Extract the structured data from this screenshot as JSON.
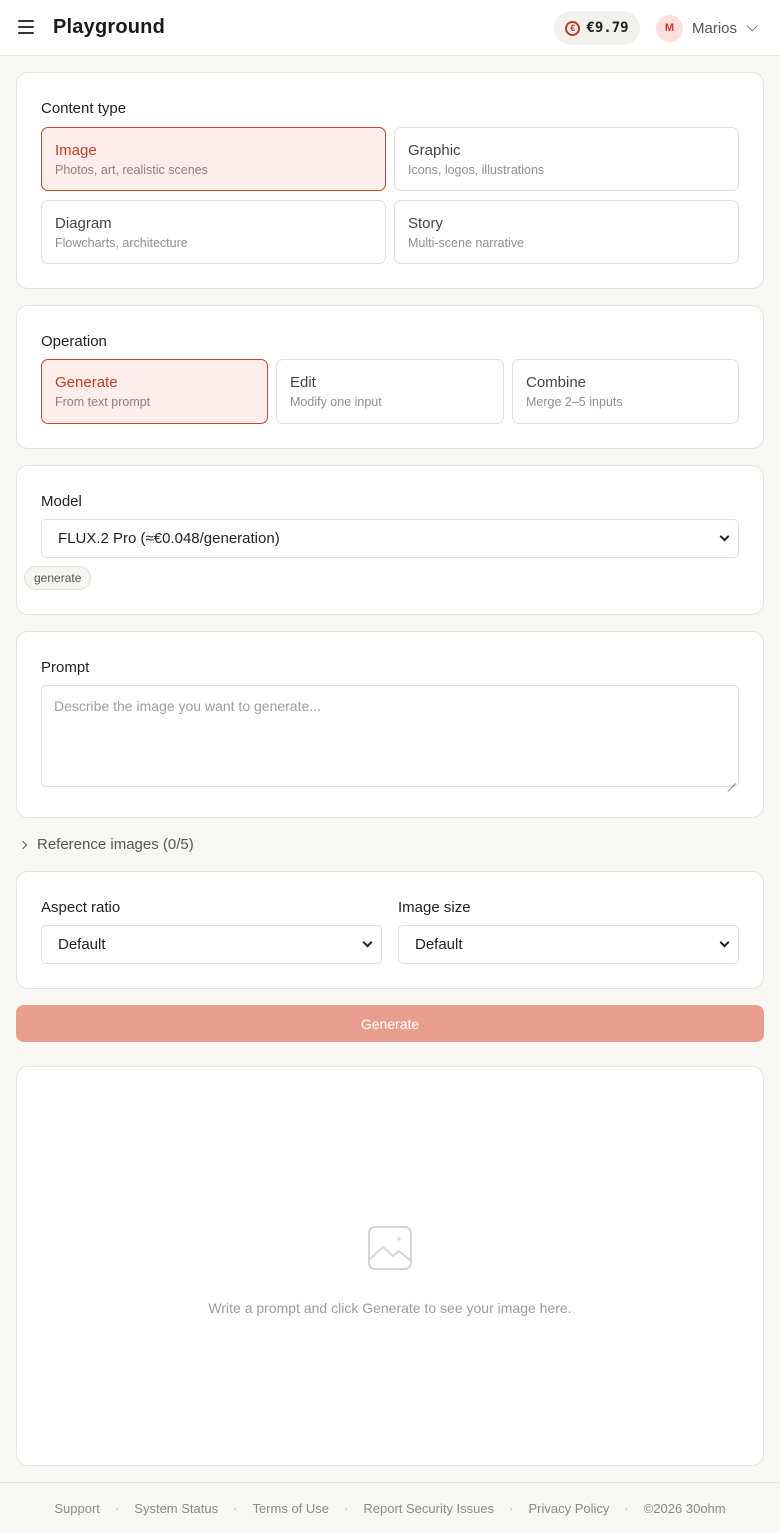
{
  "header": {
    "title": "Playground",
    "balance": "€9.79",
    "balance_icon": "€",
    "user_initial": "M",
    "user_name": "Marios"
  },
  "content_type": {
    "label": "Content type",
    "options": [
      {
        "title": "Image",
        "sub": "Photos, art, realistic scenes",
        "selected": true
      },
      {
        "title": "Graphic",
        "sub": "Icons, logos, illustrations",
        "selected": false
      },
      {
        "title": "Diagram",
        "sub": "Flowcharts, architecture",
        "selected": false
      },
      {
        "title": "Story",
        "sub": "Multi-scene narrative",
        "selected": false
      }
    ]
  },
  "operation": {
    "label": "Operation",
    "options": [
      {
        "title": "Generate",
        "sub": "From text prompt",
        "selected": true
      },
      {
        "title": "Edit",
        "sub": "Modify one input",
        "selected": false
      },
      {
        "title": "Combine",
        "sub": "Merge 2–5 inputs",
        "selected": false
      }
    ]
  },
  "model": {
    "label": "Model",
    "selected": "FLUX.2 Pro (≈€0.048/generation)",
    "tag": "generate"
  },
  "prompt": {
    "label": "Prompt",
    "placeholder": "Describe the image you want to generate..."
  },
  "reference": {
    "label": "Reference images (0/5)"
  },
  "aspect_ratio": {
    "label": "Aspect ratio",
    "selected": "Default"
  },
  "image_size": {
    "label": "Image size",
    "selected": "Default"
  },
  "generate_button": "Generate",
  "preview": {
    "empty_message": "Write a prompt and click Generate to see your image here.",
    "icon": "image-placeholder-icon"
  },
  "footer": {
    "links": [
      "Support",
      "System Status",
      "Terms of Use",
      "Report Security Issues",
      "Privacy Policy"
    ],
    "copyright": "©2026 30ohm",
    "separator": "·"
  },
  "colors": {
    "accent": "#c23b22",
    "selected_bg": "#fdeeec",
    "button": "#e99d8d",
    "background": "#f8f7f3"
  }
}
